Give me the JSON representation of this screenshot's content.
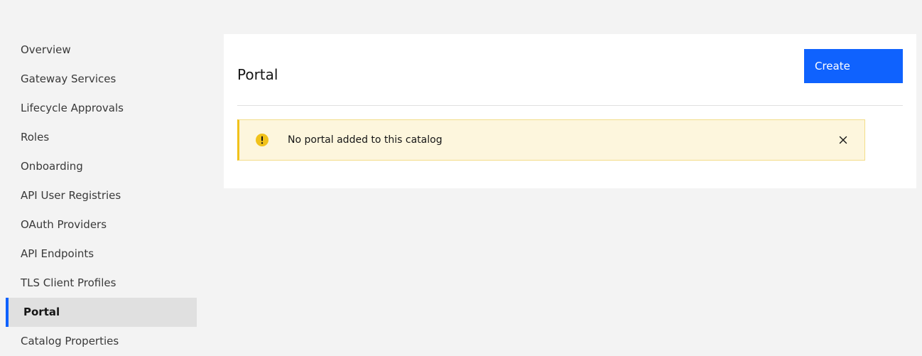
{
  "sidebar": {
    "items": [
      {
        "label": "Overview"
      },
      {
        "label": "Gateway Services"
      },
      {
        "label": "Lifecycle Approvals"
      },
      {
        "label": "Roles"
      },
      {
        "label": "Onboarding"
      },
      {
        "label": "API User Registries"
      },
      {
        "label": "OAuth Providers"
      },
      {
        "label": "API Endpoints"
      },
      {
        "label": "TLS Client Profiles"
      },
      {
        "label": "Portal",
        "active": true
      },
      {
        "label": "Catalog Properties"
      }
    ]
  },
  "main": {
    "title": "Portal",
    "create_label": "Create",
    "notification": {
      "kind": "warning",
      "icon": "warning-icon",
      "message": "No portal added to this catalog",
      "close_icon": "close-icon"
    }
  },
  "colors": {
    "accent": "#0f62fe",
    "page_background": "#f3f3f3",
    "active_item_background": "#e0e0e0",
    "warning_background": "#fdf6dd",
    "warning_icon": "#f1c21b"
  }
}
